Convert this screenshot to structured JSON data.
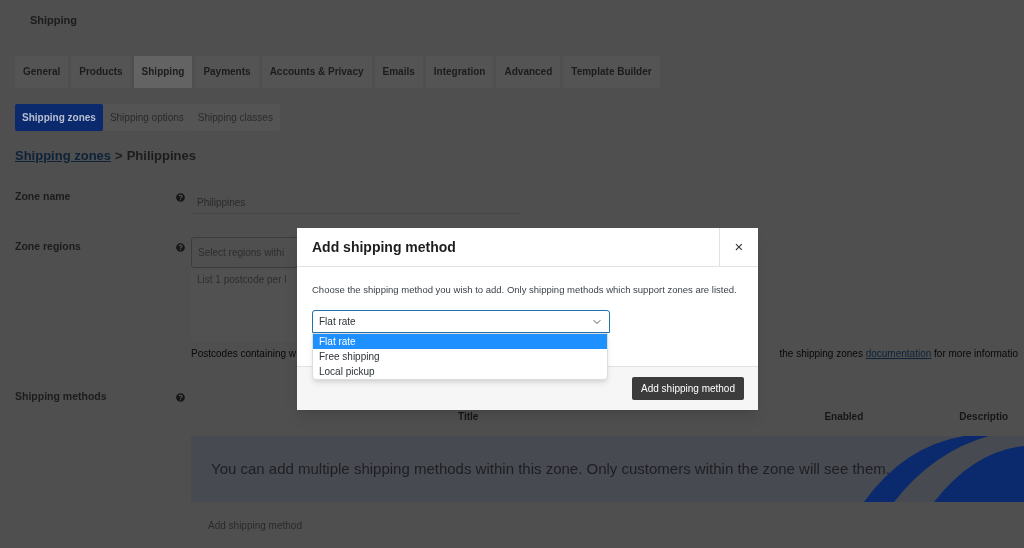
{
  "page_title": "Shipping",
  "tabs": [
    {
      "label": "General",
      "selected": false
    },
    {
      "label": "Products",
      "selected": false
    },
    {
      "label": "Shipping",
      "selected": true
    },
    {
      "label": "Payments",
      "selected": false
    },
    {
      "label": "Accounts & Privacy",
      "selected": false
    },
    {
      "label": "Emails",
      "selected": false
    },
    {
      "label": "Integration",
      "selected": false
    },
    {
      "label": "Advanced",
      "selected": false
    },
    {
      "label": "Template Builder",
      "selected": false
    }
  ],
  "subtabs": [
    {
      "label": "Shipping zones",
      "selected": true
    },
    {
      "label": "Shipping options",
      "selected": false
    },
    {
      "label": "Shipping classes",
      "selected": false
    }
  ],
  "breadcrumb": {
    "link": "Shipping zones",
    "separator": ">",
    "current": "Philippines"
  },
  "zone_name": {
    "label": "Zone name",
    "value": "Philippines"
  },
  "zone_regions": {
    "label": "Zone regions",
    "placeholder": "Select regions withi",
    "postcodes_placeholder": "List 1 postcode per l",
    "hint_start": "Postcodes containing w",
    "hint_end_before": "the shipping zones",
    "hint_link": "documentation",
    "hint_end_after": "for more informatio"
  },
  "shipping_methods": {
    "label": "Shipping methods",
    "columns": [
      "Title",
      "Enabled",
      "Descriptio"
    ],
    "notice": "You can add multiple shipping methods within this zone. Only customers within the zone will see them.",
    "add_link": "Add shipping method"
  },
  "modal": {
    "title": "Add shipping method",
    "close": "×",
    "description": "Choose the shipping method you wish to add. Only shipping methods which support zones are listed.",
    "select": {
      "value": "Flat rate",
      "expanded": true,
      "options": [
        {
          "label": "Flat rate",
          "selected": true
        },
        {
          "label": "Free shipping",
          "selected": false
        },
        {
          "label": "Local pickup",
          "selected": false
        }
      ]
    },
    "button": "Add shipping method"
  }
}
